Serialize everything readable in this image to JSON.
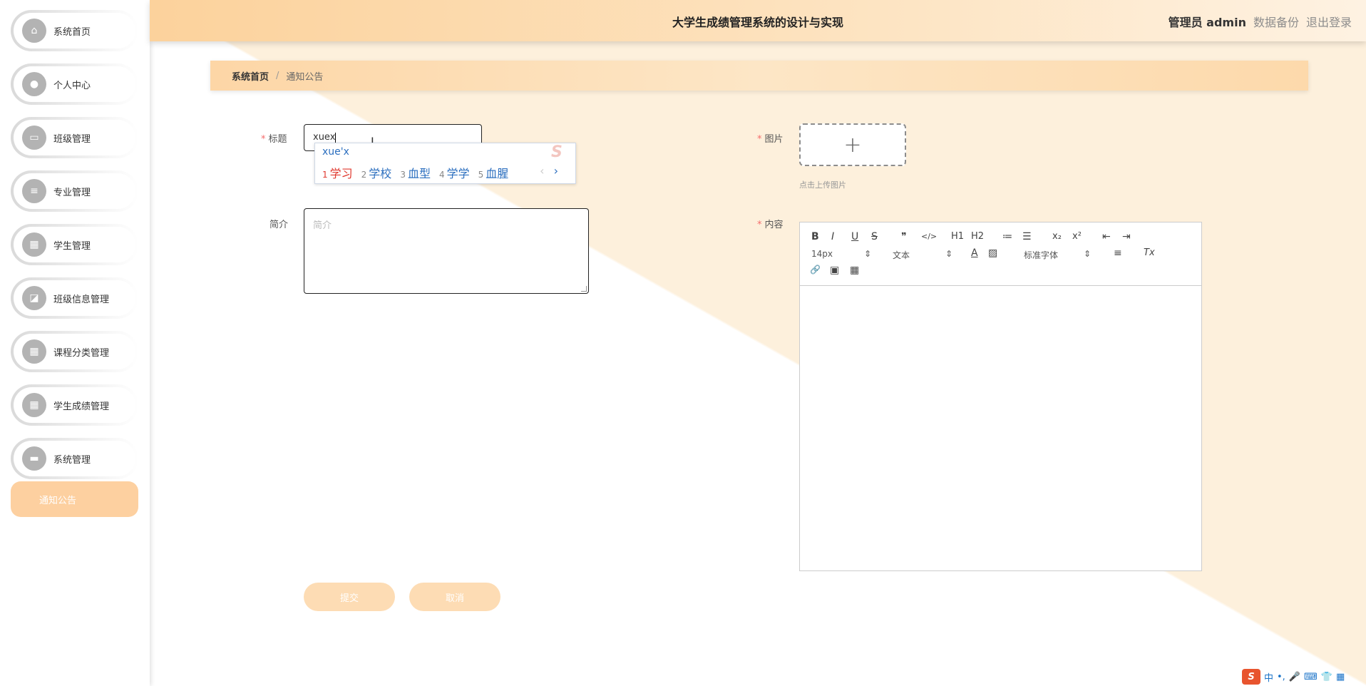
{
  "header": {
    "title": "大学生成绩管理系统的设计与实现",
    "user": "管理员 admin",
    "backup": "数据备份",
    "logout": "退出登录"
  },
  "sidebar": {
    "items": [
      {
        "label": "系统首页",
        "icon": "home-icon"
      },
      {
        "label": "个人中心",
        "icon": "user-icon"
      },
      {
        "label": "班级管理",
        "icon": "chat-icon"
      },
      {
        "label": "专业管理",
        "icon": "list-icon"
      },
      {
        "label": "学生管理",
        "icon": "grid-icon"
      },
      {
        "label": "班级信息管理",
        "icon": "chart-icon"
      },
      {
        "label": "课程分类管理",
        "icon": "grid-icon"
      },
      {
        "label": "学生成绩管理",
        "icon": "grid-icon"
      },
      {
        "label": "系统管理",
        "icon": "monitor-icon"
      }
    ],
    "active": "通知公告"
  },
  "breadcrumb": {
    "home": "系统首页",
    "separator": "/",
    "current": "通知公告"
  },
  "form": {
    "title_label": "标题",
    "title_value": "xuex",
    "intro_label": "简介",
    "intro_placeholder": "简介",
    "image_label": "图片",
    "image_plus": "+",
    "image_tip": "点击上传图片",
    "content_label": "内容",
    "submit": "提交",
    "cancel": "取消"
  },
  "ime": {
    "composition": "xue'x",
    "candidates": [
      {
        "n": "1",
        "w": "学习"
      },
      {
        "n": "2",
        "w": "学校"
      },
      {
        "n": "3",
        "w": "血型"
      },
      {
        "n": "4",
        "w": "学学"
      },
      {
        "n": "5",
        "w": "血腥"
      }
    ],
    "prev": "‹",
    "next": "›"
  },
  "editor": {
    "bold": "B",
    "italic": "I",
    "underline": "U",
    "strike": "S",
    "quote": "❞",
    "code": "</>",
    "h1": "H1",
    "h2": "H2",
    "ol": "≔",
    "ul": "☰",
    "sub": "x₂",
    "sup": "x²",
    "outdent": "⇤",
    "indent": "⇥",
    "size": "14px",
    "header": "文本",
    "font": "标准字体",
    "align": "≡",
    "clean": "Tx",
    "link": "🔗",
    "image": "▣",
    "video": "▦"
  },
  "tray": {
    "logo": "S",
    "lang": "中",
    "punct": "•,",
    "mic": "🎤",
    "kbd": "⌨",
    "skin": "👕",
    "apps": "▦"
  },
  "colors": {
    "accent": "#fdd0a0",
    "header": "#fcd29c",
    "required": "#f56c6c",
    "ime_blue": "#2c6fbf"
  }
}
